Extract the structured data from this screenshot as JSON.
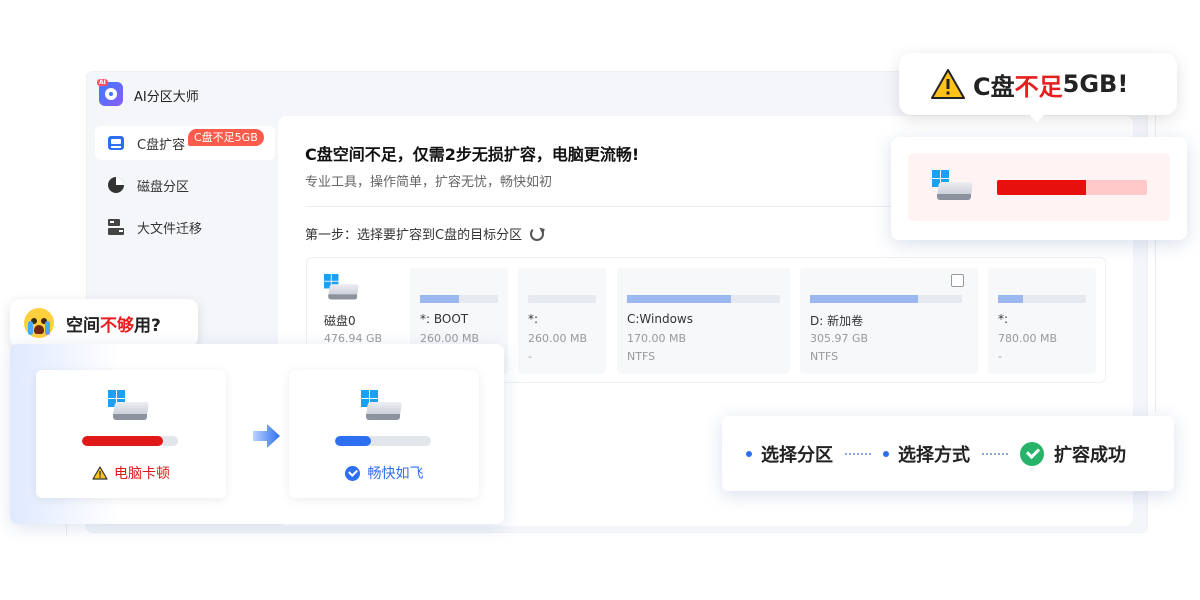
{
  "app": {
    "title": "AI分区大师"
  },
  "sidebar": {
    "items": [
      {
        "label": "C盘扩容",
        "badge": "C盘不足5GB",
        "icon": "drive-c-icon",
        "active": true
      },
      {
        "label": "磁盘分区",
        "icon": "pie-chart-icon",
        "active": false
      },
      {
        "label": "大文件迁移",
        "icon": "file-transfer-icon",
        "active": false
      }
    ]
  },
  "content": {
    "title": "C盘空间不足，仅需2步无损扩容，电脑更流畅!",
    "subtitle": "专业工具，操作简单，扩容无忧，畅快如初",
    "step_label": "第一步：选择要扩容到C盘的目标分区",
    "disk": {
      "name": "磁盘0",
      "size": "476.94 GB"
    },
    "partitions": [
      {
        "name": "*:  BOOT",
        "size": "260.00 MB",
        "fs": "",
        "fill": 0.5
      },
      {
        "name": "*:",
        "size": "260.00 MB",
        "fs": "-",
        "fill": 0.0
      },
      {
        "name": "C:Windows",
        "size": "170.00 MB",
        "fs": "NTFS",
        "fill": 0.68
      },
      {
        "name": "D: 新加卷",
        "size": "305.97 GB",
        "fs": "NTFS",
        "fill": 0.71
      },
      {
        "name": "*:",
        "size": "780.00 MB",
        "fs": "-",
        "fill": 0.28
      }
    ]
  },
  "callout_warn": {
    "prefix": "C盘",
    "highlight": "不足",
    "suffix": "5GB!",
    "usage_fill": 0.59
  },
  "callout_space": {
    "prefix": "空间",
    "highlight": "不够",
    "suffix": "用?"
  },
  "compare": {
    "before": {
      "label": "电脑卡顿",
      "fill": 0.84,
      "color": "#e01818"
    },
    "after": {
      "label": "畅快如飞",
      "fill": 0.38,
      "color": "#2d6ff0"
    }
  },
  "steps": [
    "选择分区",
    "选择方式",
    "扩容成功"
  ],
  "colors": {
    "accent": "#2d6ff0",
    "danger": "#e61e1e",
    "success": "#27b36a",
    "badge": "#ff5b4c"
  }
}
